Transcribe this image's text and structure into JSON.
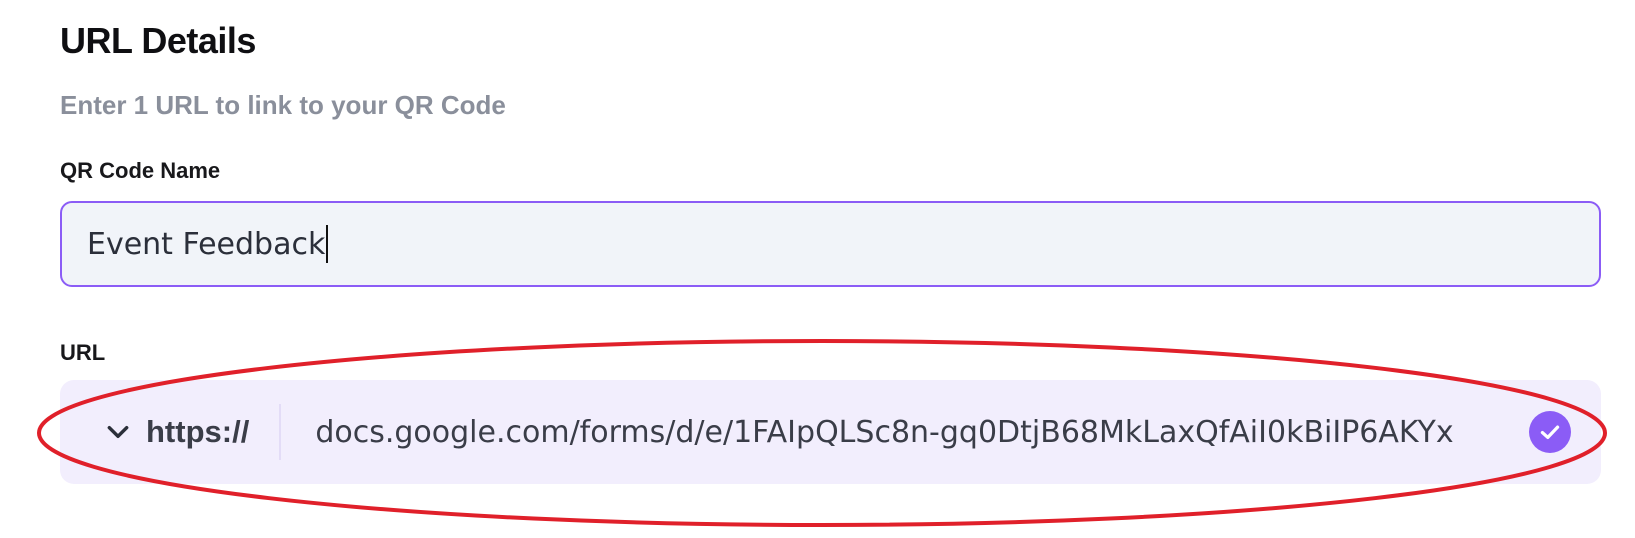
{
  "section": {
    "title": "URL Details",
    "subtitle": "Enter 1 URL to link to your QR Code"
  },
  "qr_name": {
    "label": "QR Code Name",
    "value": "Event Feedback"
  },
  "url_field": {
    "label": "URL",
    "protocol": "https://",
    "value": "docs.google.com/forms/d/e/1FAIpQLSc8n-gq0DtjB68MkLaxQfAiI0kBiIP6AKYx",
    "valid": true
  },
  "icons": {
    "protocol_dropdown": "chevron-down-icon",
    "validation": "check-circle-icon"
  },
  "colors": {
    "accent": "#8b5cf6",
    "annotation": "#e0202a",
    "input_bg": "#f1f4f9",
    "url_row_bg": "#f2eefd",
    "subtitle": "#8a8f9b"
  }
}
